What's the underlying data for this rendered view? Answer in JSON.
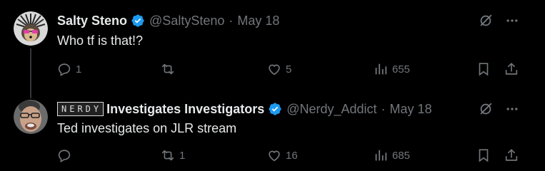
{
  "tweets": [
    {
      "author": "Salty Steno",
      "handle": "@SaltySteno",
      "separator": "·",
      "date": "May 18",
      "text": "Who tf is that!?",
      "replies": "1",
      "retweets": "",
      "likes": "5",
      "views": "655",
      "avatar": "hedgehog-avatar"
    },
    {
      "name_badge": "NERDY",
      "author": "Investigates Investigators",
      "handle": "@Nerdy_Addict",
      "separator": "·",
      "date": "May 18",
      "text": "Ted investigates on JLR stream",
      "replies": "",
      "retweets": "1",
      "likes": "16",
      "views": "685",
      "avatar": "man-photo-avatar"
    }
  ],
  "colors": {
    "background": "#000000",
    "text_primary": "#e7e9ea",
    "text_secondary": "#71767b",
    "verified_blue": "#1d9bf0",
    "thread_line": "#333639"
  },
  "icons": [
    "grok-icon",
    "more-icon",
    "reply-icon",
    "retweet-icon",
    "like-icon",
    "views-icon",
    "bookmark-icon",
    "share-icon",
    "verified-icon"
  ]
}
